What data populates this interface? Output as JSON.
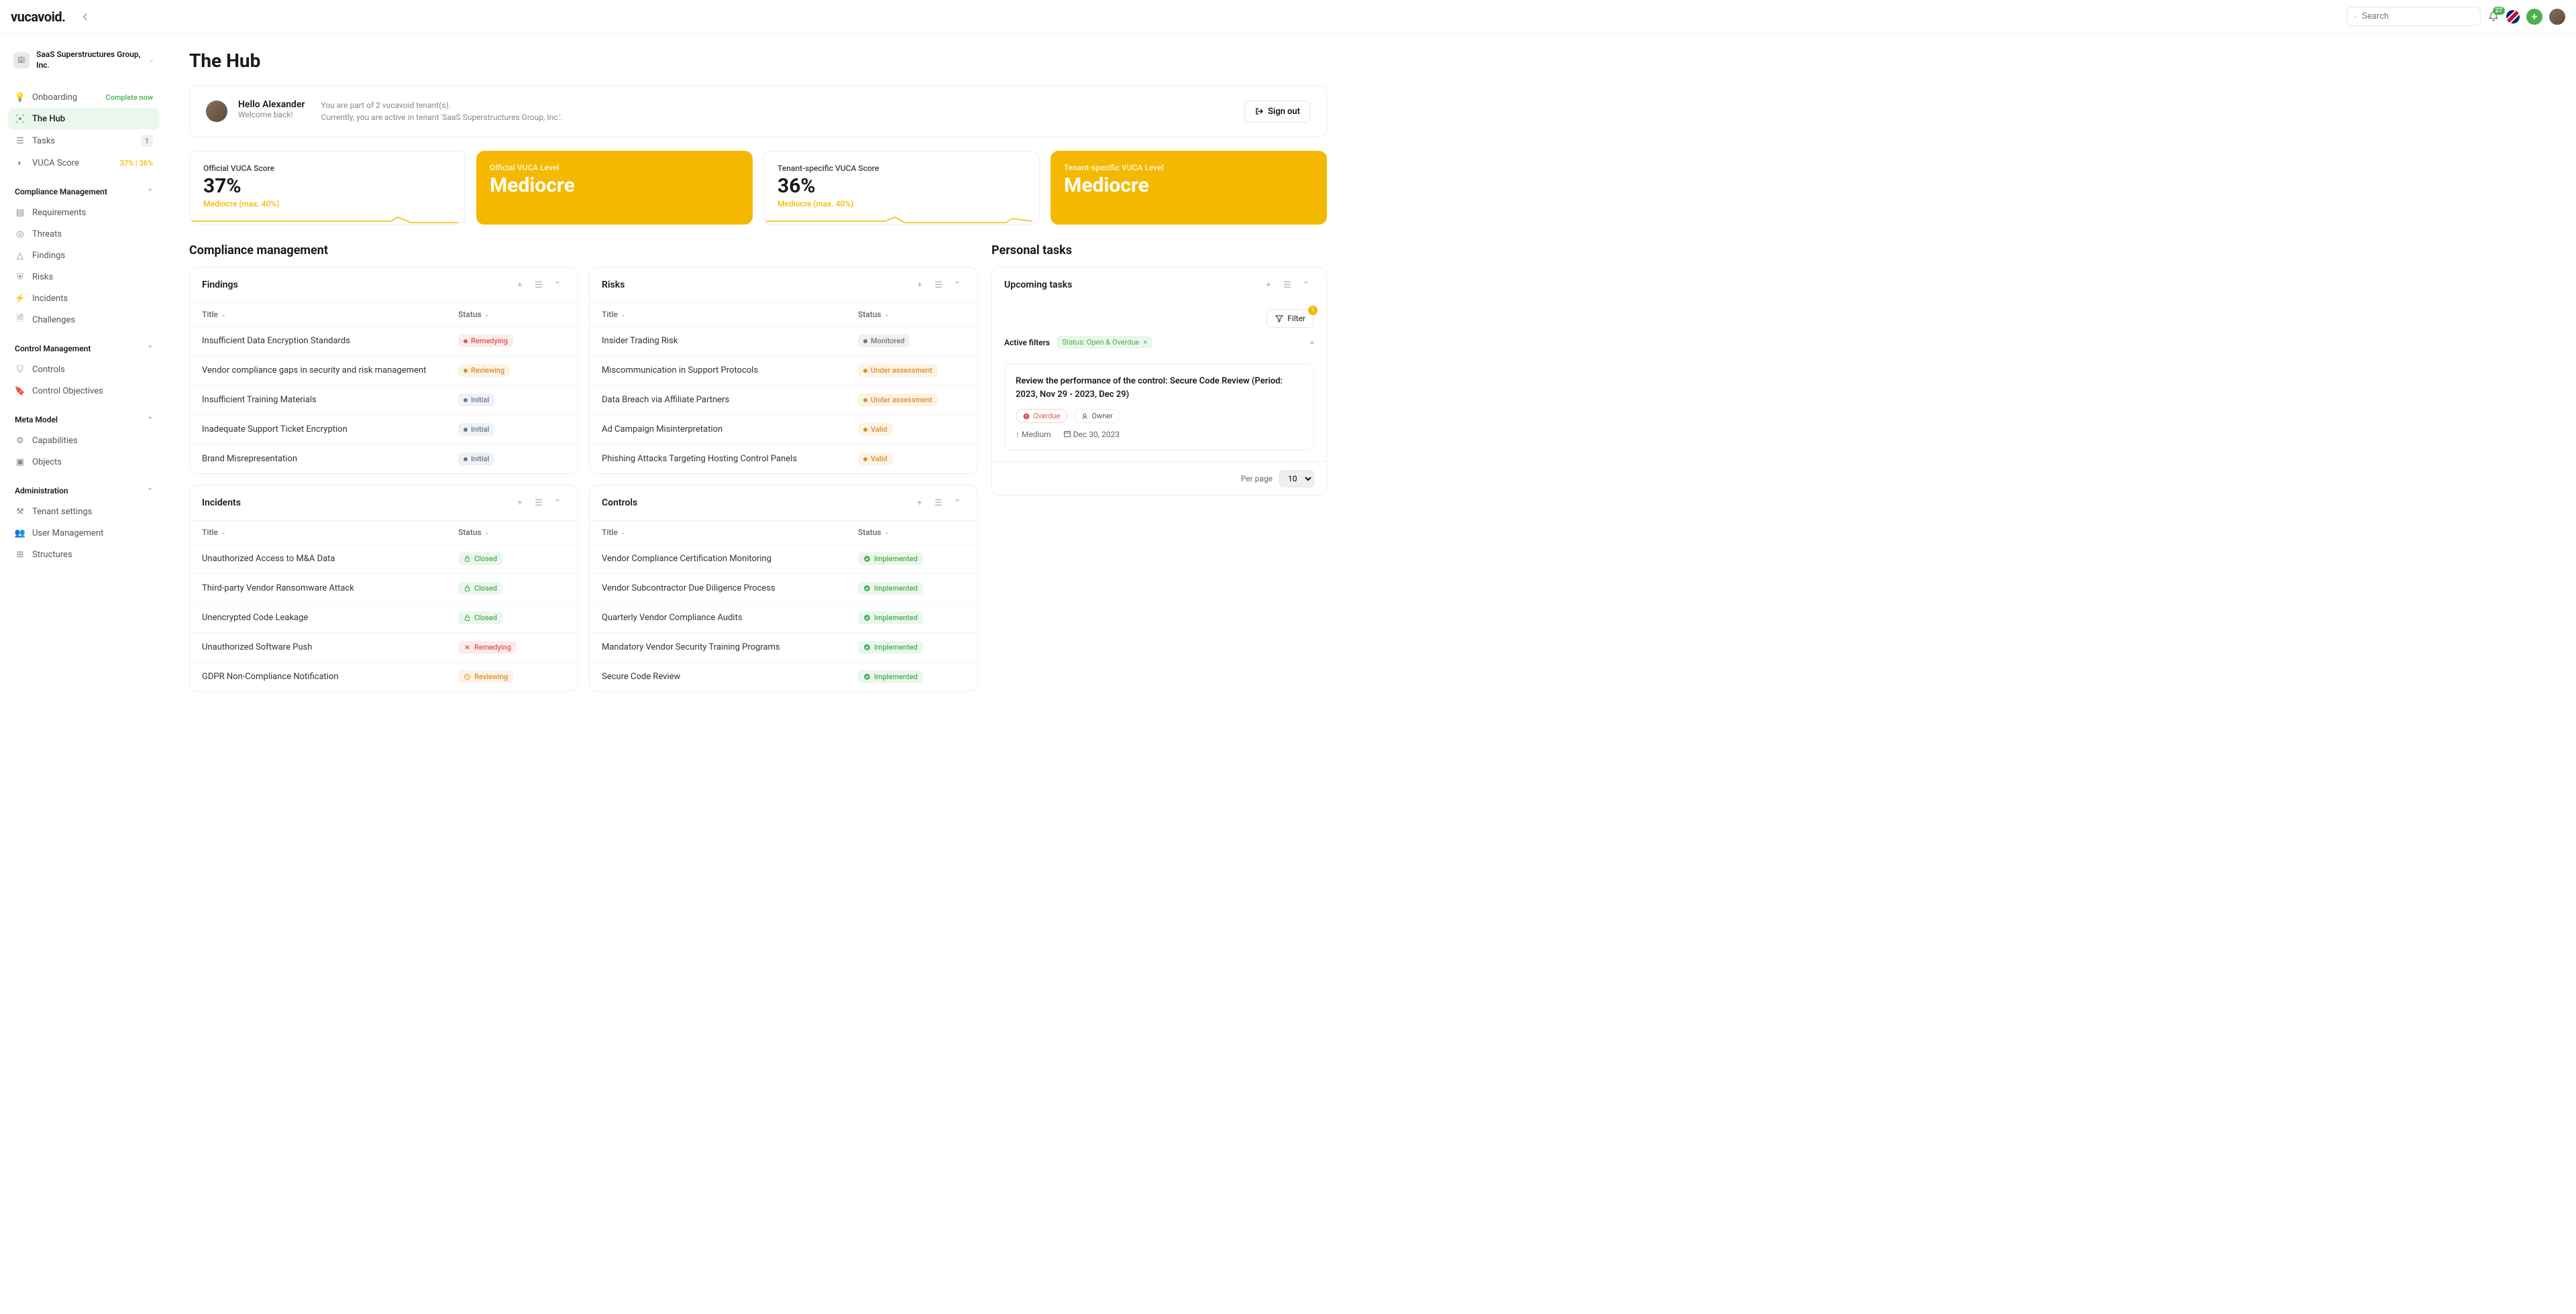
{
  "brand": "vucavoid.",
  "search": {
    "placeholder": "Search"
  },
  "notifications_count": "27",
  "tenant": {
    "name": "SaaS Superstructures Group, Inc."
  },
  "nav": {
    "onboarding": "Onboarding",
    "onboarding_pill": "Complete now",
    "hub": "The Hub",
    "tasks": "Tasks",
    "tasks_count": "1",
    "vuca": "VUCA Score",
    "vuca_pill": "37% | 36%",
    "compliance_header": "Compliance Management",
    "requirements": "Requirements",
    "threats": "Threats",
    "findings": "Findings",
    "risks": "Risks",
    "incidents": "Incidents",
    "challenges": "Challenges",
    "control_header": "Control Management",
    "controls": "Controls",
    "control_obj": "Control Objectives",
    "meta_header": "Meta Model",
    "capabilities": "Capabilities",
    "objects": "Objects",
    "admin_header": "Administration",
    "tenant_settings": "Tenant settings",
    "user_mgmt": "User Management",
    "structures": "Structures"
  },
  "page_title": "The Hub",
  "greet": {
    "hello": "Hello Alexander",
    "welcome": "Welcome back!",
    "line1": "You are part of 2 vucavoid tenant(s).",
    "line2": "Currently, you are active in tenant 'SaaS Superstructures Group, Inc.'.",
    "signout": "Sign out"
  },
  "scores": {
    "s1_label": "Official VUCA Score",
    "s1_val": "37%",
    "s1_meta": "Mediocre (max. 40%)",
    "s2_label": "Official VUCA Level",
    "s2_val": "Mediocre",
    "s3_label": "Tenant-specific VUCA Score",
    "s3_val": "36%",
    "s3_meta": "Mediocre (max. 40%)",
    "s4_label": "Tenant-specific VUCA Level",
    "s4_val": "Mediocre"
  },
  "sections": {
    "compliance": "Compliance management",
    "personal": "Personal tasks"
  },
  "panels": {
    "findings": "Findings",
    "risks": "Risks",
    "incidents": "Incidents",
    "controls": "Controls",
    "upcoming": "Upcoming tasks"
  },
  "cols": {
    "title": "Title",
    "status": "Status"
  },
  "status": {
    "remedying": "Remedying",
    "reviewing": "Reviewing",
    "initial": "Initial",
    "monitored": "Monitored",
    "under": "Under assessment",
    "valid": "Valid",
    "closed": "Closed",
    "implemented": "Implemented"
  },
  "findings": [
    {
      "t": "Insufficient Data Encryption Standards",
      "s": "remedying"
    },
    {
      "t": "Vendor compliance gaps in security and risk management",
      "s": "reviewing"
    },
    {
      "t": "Insufficient Training Materials",
      "s": "initial"
    },
    {
      "t": "Inadequate Support Ticket Encryption",
      "s": "initial"
    },
    {
      "t": "Brand Misrepresentation",
      "s": "initial"
    }
  ],
  "risks": [
    {
      "t": "Insider Trading Risk",
      "s": "monitored"
    },
    {
      "t": "Miscommunication in Support Protocols",
      "s": "under"
    },
    {
      "t": "Data Breach via Affiliate Partners",
      "s": "under"
    },
    {
      "t": "Ad Campaign Misinterpretation",
      "s": "valid"
    },
    {
      "t": "Phishing Attacks Targeting Hosting Control Panels",
      "s": "valid"
    }
  ],
  "incidents": [
    {
      "t": "Unauthorized Access to M&A Data",
      "s": "closed"
    },
    {
      "t": "Third-party Vendor Ransomware Attack",
      "s": "closed"
    },
    {
      "t": "Unencrypted Code Leakage",
      "s": "closed"
    },
    {
      "t": "Unauthorized Software Push",
      "s": "remedying"
    },
    {
      "t": "GDPR Non-Compliance Notification",
      "s": "reviewing"
    }
  ],
  "controls": [
    {
      "t": "Vendor Compliance Certification Monitoring",
      "s": "implemented"
    },
    {
      "t": "Vendor Subcontractor Due Diligence Process",
      "s": "implemented"
    },
    {
      "t": "Quarterly Vendor Compliance Audits",
      "s": "implemented"
    },
    {
      "t": "Mandatory Vendor Security Training Programs",
      "s": "implemented"
    },
    {
      "t": "Secure Code Review",
      "s": "implemented"
    }
  ],
  "filter": {
    "label": "Filter",
    "count": "1",
    "active": "Active filters",
    "chip": "Status: Open & Overdue"
  },
  "task": {
    "title": "Review the performance of the control: Secure Code Review (Period: 2023, Nov 29 - 2023, Dec 29)",
    "overdue": "Overdue",
    "owner": "Owner",
    "priority": "Medium",
    "due": "Dec 30, 2023"
  },
  "perpage": {
    "label": "Per page",
    "value": "10"
  }
}
